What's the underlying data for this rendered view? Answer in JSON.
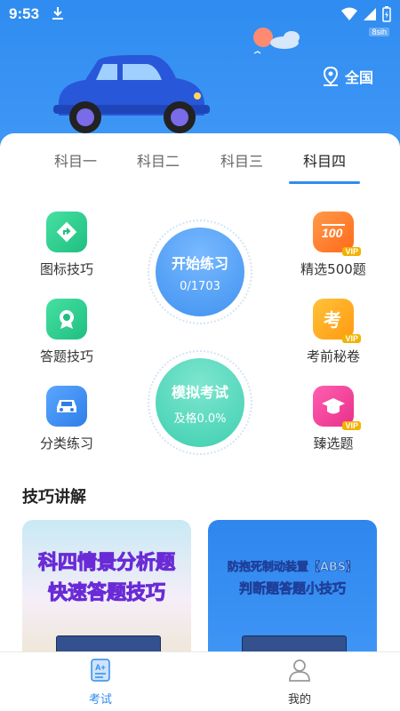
{
  "status_bar": {
    "time": "9:53",
    "speed": "8sih"
  },
  "location": {
    "label": "全国"
  },
  "tabs": [
    {
      "label": "科目一",
      "active": false
    },
    {
      "label": "科目二",
      "active": false
    },
    {
      "label": "科目三",
      "active": false
    },
    {
      "label": "科目四",
      "active": true
    }
  ],
  "features_left": [
    {
      "label": "图标技巧",
      "icon": "road-sign-icon",
      "color": "#2fcf8f"
    },
    {
      "label": "答题技巧",
      "icon": "badge-icon",
      "color": "#2fcf8f"
    },
    {
      "label": "分类练习",
      "icon": "car-icon",
      "color": "#3d8ff0"
    }
  ],
  "features_right": [
    {
      "label": "精选500题",
      "icon": "hundred-icon",
      "color": "#ff7a2e",
      "badge": "VIP"
    },
    {
      "label": "考前秘卷",
      "icon": "exam-icon",
      "color": "#ffa41b",
      "badge": "VIP"
    },
    {
      "label": "臻选题",
      "icon": "graduation-icon",
      "color": "#f0489a",
      "badge": "VIP"
    }
  ],
  "practice": {
    "title": "开始练习",
    "progress": "0/1703"
  },
  "mock_exam": {
    "title": "模拟考试",
    "pass_rate": "及格0.0%"
  },
  "section": {
    "title": "技巧讲解"
  },
  "lessons": [
    {
      "line1": "科四情景分析题",
      "line2": "快速答题技巧"
    },
    {
      "line1": "防抱死制动装置【ABS】",
      "line2": "判断题答题小技巧"
    }
  ],
  "bottom_nav": [
    {
      "label": "考试",
      "icon": "exam-tab-icon",
      "active": true
    },
    {
      "label": "我的",
      "icon": "profile-icon",
      "active": false
    }
  ],
  "colors": {
    "primary": "#2f8cf0",
    "practice_circle": "#4a9df2",
    "mock_circle": "#3ecfb0"
  }
}
